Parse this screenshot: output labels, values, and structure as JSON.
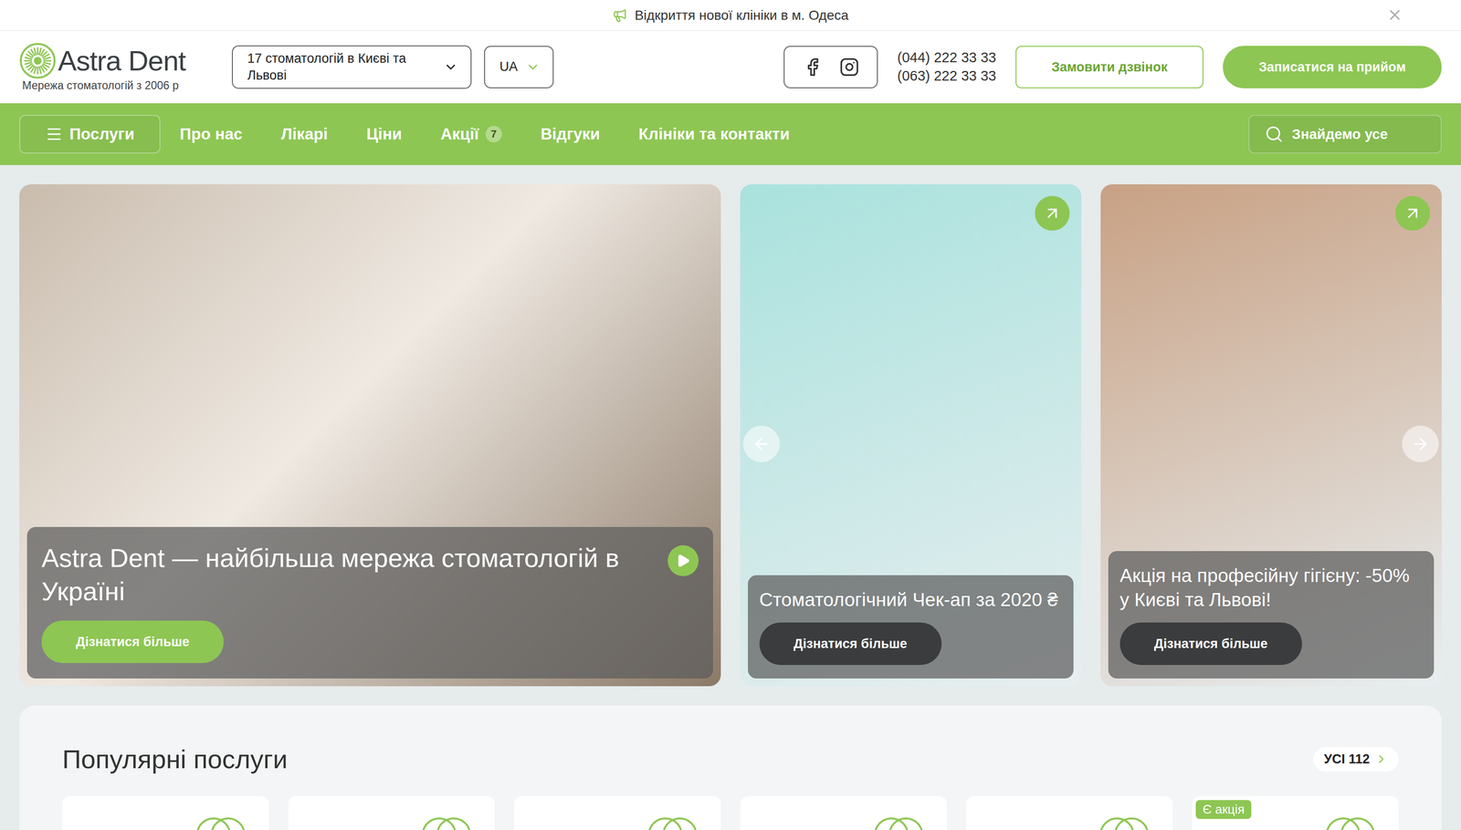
{
  "announcement": {
    "text": "Відкриття нової клініки в м. Одеса"
  },
  "logo": {
    "name": "Astra Dent",
    "tagline": "Мережа стоматологій з 2006 р"
  },
  "clinic_select": {
    "label": "17 стоматологій в Києві та Львові",
    "expanded": false
  },
  "language_select": {
    "label": "UA",
    "expanded": false
  },
  "phones": [
    "(044) 222 33 33",
    "(063) 222 33 33"
  ],
  "header_buttons": [
    {
      "label": "Замовити дзвінок",
      "kind": "outline"
    },
    {
      "label": "Записатися на прийом",
      "kind": "filled"
    }
  ],
  "nav": [
    {
      "label": "Послуги",
      "kind": "menu",
      "badge": ""
    },
    {
      "label": "Про нас",
      "kind": "link",
      "badge": ""
    },
    {
      "label": "Лікарі",
      "kind": "link",
      "badge": ""
    },
    {
      "label": "Ціни",
      "kind": "link",
      "badge": ""
    },
    {
      "label": "Акції",
      "kind": "link",
      "badge": "7"
    },
    {
      "label": "Відгуки",
      "kind": "link",
      "badge": ""
    },
    {
      "label": "Клініки та контакти",
      "kind": "link",
      "badge": ""
    }
  ],
  "search": {
    "placeholder": "Знайдемо усе"
  },
  "slides": [
    {
      "title": "Astra Dent — найбільша мережа стоматологій в Україні",
      "button": "Дізнатися більше",
      "kind": "main",
      "color": "#c9bcad"
    },
    {
      "title": "Стоматологічний Чек-ап за 2020 ₴",
      "button": "Дізнатися більше",
      "kind": "side",
      "color": "#a9e2dd"
    },
    {
      "title": "Акція на професійну гігієну: -50% у Києві та Львові!",
      "button": "Дізнатися більше",
      "kind": "side",
      "color": "#c8a184"
    }
  ],
  "popular": {
    "title": "Популярні послуги",
    "all_link": "УСІ 112",
    "promo_label": "Є акція",
    "cards": [
      {
        "promo": false
      },
      {
        "promo": false
      },
      {
        "promo": false
      },
      {
        "promo": false
      },
      {
        "promo": false
      },
      {
        "promo": true
      }
    ]
  }
}
